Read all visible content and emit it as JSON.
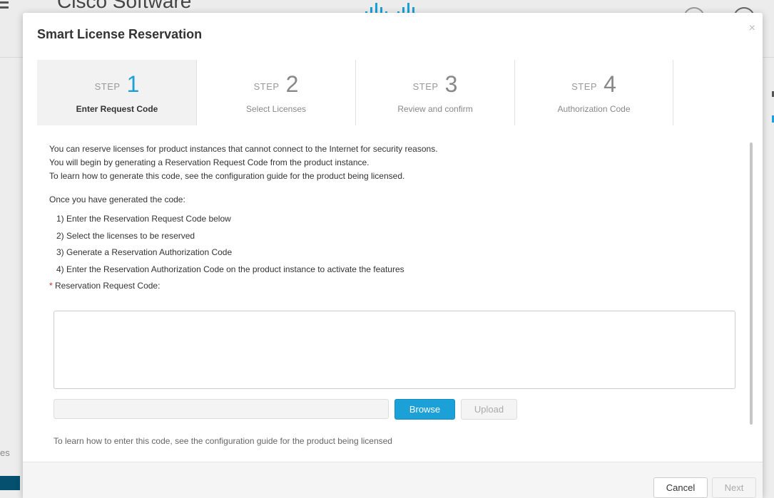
{
  "background": {
    "app_title": "Cisco Software",
    "side_text": "es",
    "logo_icon": "cisco-logo-icon",
    "colors": {
      "brand": "#1ba0d7",
      "footer": "#05506e"
    }
  },
  "modal": {
    "title": "Smart License Reservation",
    "close_label": "×",
    "steps": [
      {
        "word": "STEP",
        "number": "1",
        "label": "Enter Request Code",
        "active": true
      },
      {
        "word": "STEP",
        "number": "2",
        "label": "Select Licenses",
        "active": false
      },
      {
        "word": "STEP",
        "number": "3",
        "label": "Review and confirm",
        "active": false
      },
      {
        "word": "STEP",
        "number": "4",
        "label": "Authorization Code",
        "active": false
      }
    ],
    "intro": [
      "You can reserve licenses for product instances that cannot connect to the Internet for security reasons.",
      "You will begin by generating a Reservation Request Code from the product instance.",
      "To learn how to generate this code, see the configuration guide for the product being licensed."
    ],
    "once_text": "Once you have generated the code:",
    "instructions": [
      "1) Enter the Reservation Request Code below",
      "2) Select the licenses to be reserved",
      "3) Generate a Reservation Authorization Code",
      "4) Enter the Reservation Authorization Code on the product instance to activate the features"
    ],
    "required_marker": "*",
    "request_code_label": "Reservation Request Code:",
    "request_code_value": "",
    "file_value": "",
    "browse_label": "Browse",
    "upload_label": "Upload",
    "hint": "To learn how to enter this code, see the configuration guide for the product being licensed",
    "footer": {
      "cancel_label": "Cancel",
      "next_label": "Next"
    },
    "colors": {
      "accent": "#1ba0d7",
      "required": "#cc2e2e"
    }
  }
}
